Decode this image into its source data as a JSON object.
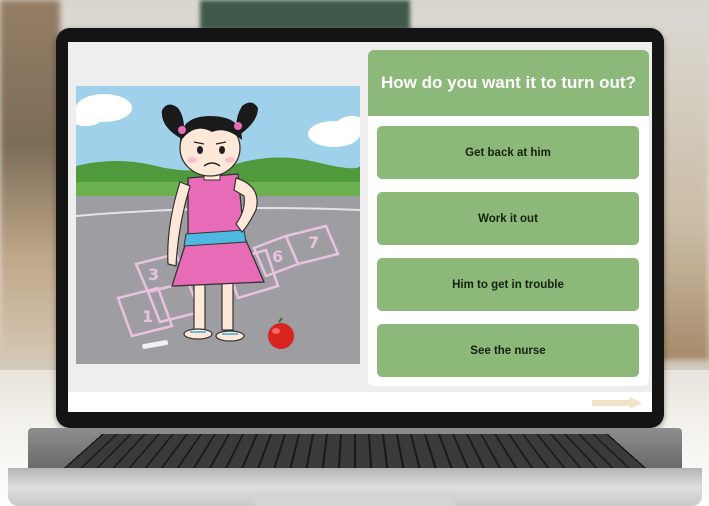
{
  "question": "How do you want it to turn out?",
  "choices": [
    {
      "label": "Get back at him"
    },
    {
      "label": "Work it out"
    },
    {
      "label": "Him to get in trouble"
    },
    {
      "label": "See the nurse"
    }
  ],
  "scene": {
    "hopscotch_numbers": [
      "3",
      "1",
      "6",
      "7"
    ],
    "description_icon": "sad-girl-hopscotch-illustration"
  },
  "colors": {
    "accent_green": "#8cb87a",
    "button_text": "#15220f",
    "panel": "#ffffff",
    "dress_pink": "#e86bb7"
  }
}
